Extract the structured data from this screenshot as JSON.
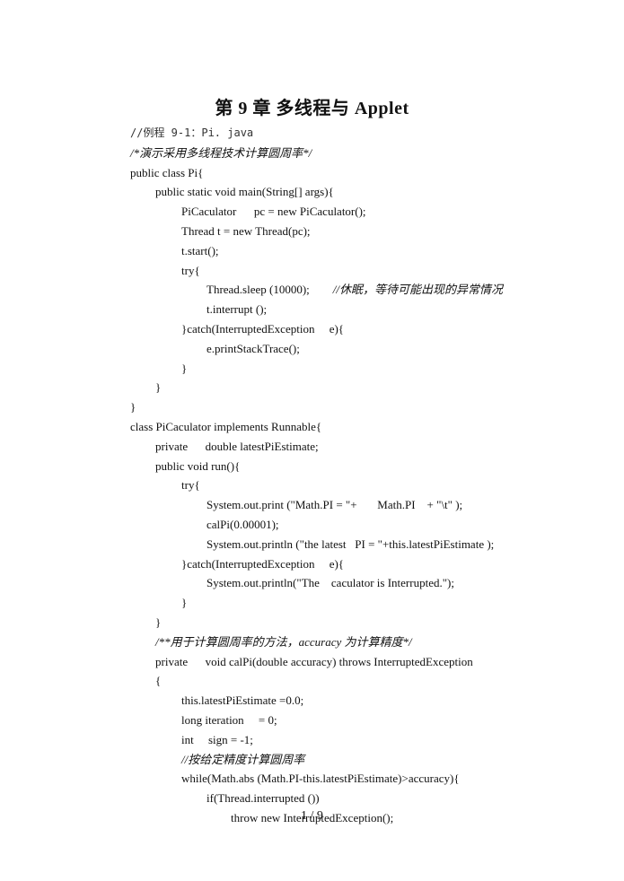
{
  "document": {
    "title": "第 9 章  多线程与 Applet",
    "page_number": "1  /  9"
  },
  "code_lines": [
    {
      "text": "//例程 9-1：Pi. java",
      "indent": 0,
      "style": "mono"
    },
    {
      "text": "/*演示采用多线程技术计算圆周率*/",
      "indent": 0,
      "style": "cmt"
    },
    {
      "text": "public class Pi{",
      "indent": 0,
      "style": ""
    },
    {
      "text": "public static void main(String[] args){",
      "indent": 1,
      "style": ""
    },
    {
      "text": "PiCaculator      pc = new PiCaculator();",
      "indent": 2,
      "style": ""
    },
    {
      "text": "Thread t = new Thread(pc);",
      "indent": 2,
      "style": ""
    },
    {
      "text": "t.start();",
      "indent": 2,
      "style": ""
    },
    {
      "text": "try{",
      "indent": 2,
      "style": ""
    },
    {
      "text": "Thread.sleep (10000);",
      "indent": 3,
      "style": "",
      "comment": "//休眠，等待可能出现的异常情况"
    },
    {
      "text": "t.interrupt ();",
      "indent": 3,
      "style": ""
    },
    {
      "text": "}catch(InterruptedException     e){",
      "indent": 2,
      "style": ""
    },
    {
      "text": "e.printStackTrace();",
      "indent": 3,
      "style": ""
    },
    {
      "text": "}",
      "indent": 2,
      "style": ""
    },
    {
      "text": "}",
      "indent": 1,
      "style": ""
    },
    {
      "text": "}",
      "indent": 0,
      "style": ""
    },
    {
      "text": "class PiCaculator implements Runnable{",
      "indent": 0,
      "style": ""
    },
    {
      "text": "private      double latestPiEstimate;",
      "indent": 1,
      "style": ""
    },
    {
      "text": "public void run(){",
      "indent": 1,
      "style": ""
    },
    {
      "text": "try{",
      "indent": 2,
      "style": ""
    },
    {
      "text": "System.out.print (\"Math.PI = \"+       Math.PI    + \"\\t\" );",
      "indent": 3,
      "style": ""
    },
    {
      "text": "calPi(0.00001);",
      "indent": 3,
      "style": ""
    },
    {
      "text": "System.out.println (\"the latest   PI = \"+this.latestPiEstimate );",
      "indent": 3,
      "style": ""
    },
    {
      "text": "}catch(InterruptedException     e){",
      "indent": 2,
      "style": ""
    },
    {
      "text": "System.out.println(\"The    caculator is Interrupted.\");",
      "indent": 3,
      "style": ""
    },
    {
      "text": "}",
      "indent": 2,
      "style": ""
    },
    {
      "text": "}",
      "indent": 1,
      "style": ""
    },
    {
      "text": "/**用于计算圆周率的方法，accuracy 为计算精度*/",
      "indent": 1,
      "style": "cmt"
    },
    {
      "text": "private      void calPi(double accuracy) throws InterruptedException",
      "indent": 1,
      "style": ""
    },
    {
      "text": "{",
      "indent": 1,
      "style": ""
    },
    {
      "text": "this.latestPiEstimate =0.0;",
      "indent": 2,
      "style": ""
    },
    {
      "text": "long iteration     = 0;",
      "indent": 2,
      "style": ""
    },
    {
      "text": "int     sign = -1;",
      "indent": 2,
      "style": ""
    },
    {
      "text": "//按给定精度计算圆周率",
      "indent": 2,
      "style": "cmt"
    },
    {
      "text": "while(Math.abs (Math.PI-this.latestPiEstimate)>accuracy){",
      "indent": 2,
      "style": ""
    },
    {
      "text": "if(Thread.interrupted ())",
      "indent": 3,
      "style": ""
    },
    {
      "text": "throw new InterruptedException();",
      "indent": 4,
      "style": ""
    }
  ]
}
